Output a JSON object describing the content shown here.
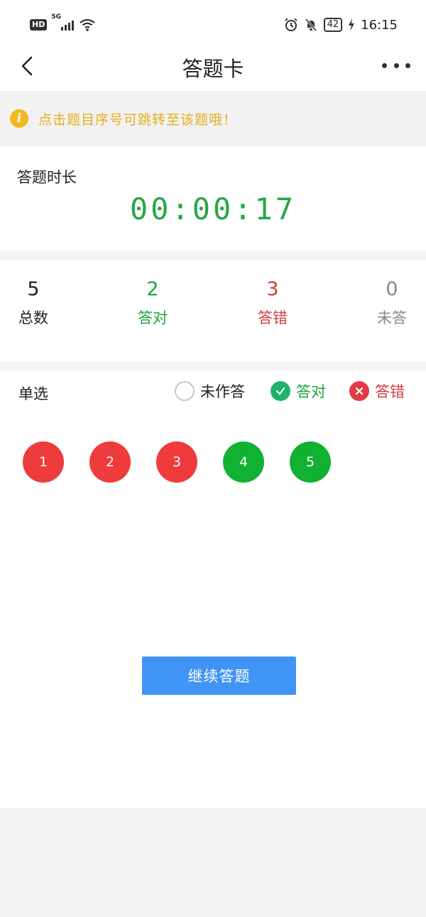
{
  "status_bar": {
    "hd": "HD",
    "network": "5G",
    "battery": "42",
    "time": "16:15",
    "icons": [
      "hd-icon",
      "signal-icon",
      "wifi-icon",
      "alarm-icon",
      "bell-muted-icon",
      "battery-icon",
      "charging-icon"
    ]
  },
  "nav": {
    "title": "答题卡",
    "back_icon": "back-chevron-icon",
    "more_icon": "more-dots-icon"
  },
  "tip": {
    "icon": "info-icon",
    "icon_glyph": "i",
    "text": "点击题目序号可跳转至该题哦！",
    "color": "#e8ad1c"
  },
  "timer": {
    "label": "答题时长",
    "value": "00:00:17",
    "color": "#27a745"
  },
  "stats": {
    "total": {
      "value": "5",
      "label": "总数"
    },
    "correct": {
      "value": "2",
      "label": "答对"
    },
    "wrong": {
      "value": "3",
      "label": "答错"
    },
    "unanswered": {
      "value": "0",
      "label": "未答"
    }
  },
  "section": {
    "type_label": "单选",
    "legend": {
      "unanswered": "未作答",
      "correct": "答对",
      "wrong": "答错"
    }
  },
  "questions": [
    {
      "number": "1",
      "status": "wrong"
    },
    {
      "number": "2",
      "status": "wrong"
    },
    {
      "number": "3",
      "status": "wrong"
    },
    {
      "number": "4",
      "status": "correct"
    },
    {
      "number": "5",
      "status": "correct"
    }
  ],
  "colors": {
    "wrong": "#ee3b3b",
    "correct": "#11b232",
    "primary_button": "#3f94f5"
  },
  "continue_button": "继续答题"
}
